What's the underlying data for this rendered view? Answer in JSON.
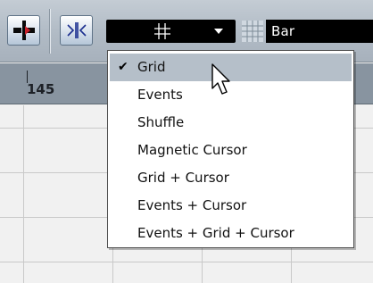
{
  "toolbar": {
    "snap_toggle_icon": "snap-on-off-icon",
    "xfade_toggle_icon": "snap-to-zero-crossing-icon",
    "snap_mode_icon": "grid-icon",
    "quantize_icon": "quantize-grid-icon",
    "quantize_value": "Bar"
  },
  "ruler": {
    "position_label": "145"
  },
  "snap_menu": {
    "items": [
      {
        "label": "Grid",
        "checked": true
      },
      {
        "label": "Events",
        "checked": false
      },
      {
        "label": "Shuffle",
        "checked": false
      },
      {
        "label": "Magnetic Cursor",
        "checked": false
      },
      {
        "label": "Grid + Cursor",
        "checked": false
      },
      {
        "label": "Events + Cursor",
        "checked": false
      },
      {
        "label": "Events + Grid + Cursor",
        "checked": false
      }
    ],
    "check_glyph": "✔"
  },
  "colors": {
    "menu_highlight": "#b5bfc9",
    "field_background": "#000000",
    "toolbar_background": "#b2bcc6",
    "ruler_background": "#8894a0"
  }
}
